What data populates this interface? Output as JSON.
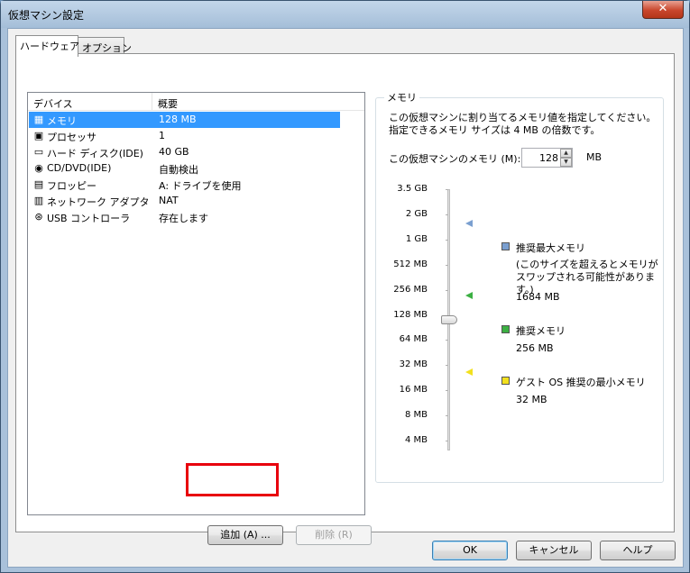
{
  "window": {
    "title": "仮想マシン設定",
    "close_glyph": "✕"
  },
  "tabs": [
    {
      "label": "ハードウェア",
      "active": true
    },
    {
      "label": "オプション",
      "active": false
    }
  ],
  "device_list": {
    "headers": {
      "device": "デバイス",
      "summary": "概要"
    },
    "rows": [
      {
        "icon": "memory-icon",
        "glyph": "▦",
        "name": "メモリ",
        "value": "128 MB",
        "selected": true
      },
      {
        "icon": "processor-icon",
        "glyph": "▣",
        "name": "プロセッサ",
        "value": "1"
      },
      {
        "icon": "hard-disk-icon",
        "glyph": "▭",
        "name": "ハード ディスク(IDE)",
        "value": "40 GB"
      },
      {
        "icon": "cd-dvd-icon",
        "glyph": "◉",
        "name": "CD/DVD(IDE)",
        "value": "自動検出"
      },
      {
        "icon": "floppy-icon",
        "glyph": "▤",
        "name": "フロッピー",
        "value": "A: ドライブを使用"
      },
      {
        "icon": "network-adapter-icon",
        "glyph": "▥",
        "name": "ネットワーク アダプタ",
        "value": "NAT"
      },
      {
        "icon": "usb-controller-icon",
        "glyph": "⊛",
        "name": "USB コントローラ",
        "value": "存在します"
      }
    ]
  },
  "buttons": {
    "add": "追加 (A) ...",
    "remove": "削除 (R)",
    "ok": "OK",
    "cancel": "キャンセル",
    "help": "ヘルプ"
  },
  "memory": {
    "group_label": "メモリ",
    "description": "この仮想マシンに割り当てるメモリ値を指定してください。指定できるメモリ サイズは 4 MB の倍数です。",
    "field_label": "この仮想マシンのメモリ (M):",
    "value": "128",
    "unit": "MB",
    "scale_labels": [
      "3.5 GB",
      "2 GB",
      "1 GB",
      "512 MB",
      "256 MB",
      "128 MB",
      "64 MB",
      "32 MB",
      "16 MB",
      "8 MB",
      "4 MB"
    ],
    "slider_value": "128 MB",
    "legend": {
      "max": {
        "label": "推奨最大メモリ",
        "note": "(このサイズを超えるとメモリがスワップされる可能性があります。)",
        "value": "1684 MB",
        "color": "#7a9fd0"
      },
      "recommended": {
        "label": "推奨メモリ",
        "value": "256 MB",
        "color": "#3cb043"
      },
      "min": {
        "label": "ゲスト OS 推奨の最小メモリ",
        "value": "32 MB",
        "color": "#f2e01e"
      }
    }
  },
  "highlight_color": "#e8000d"
}
